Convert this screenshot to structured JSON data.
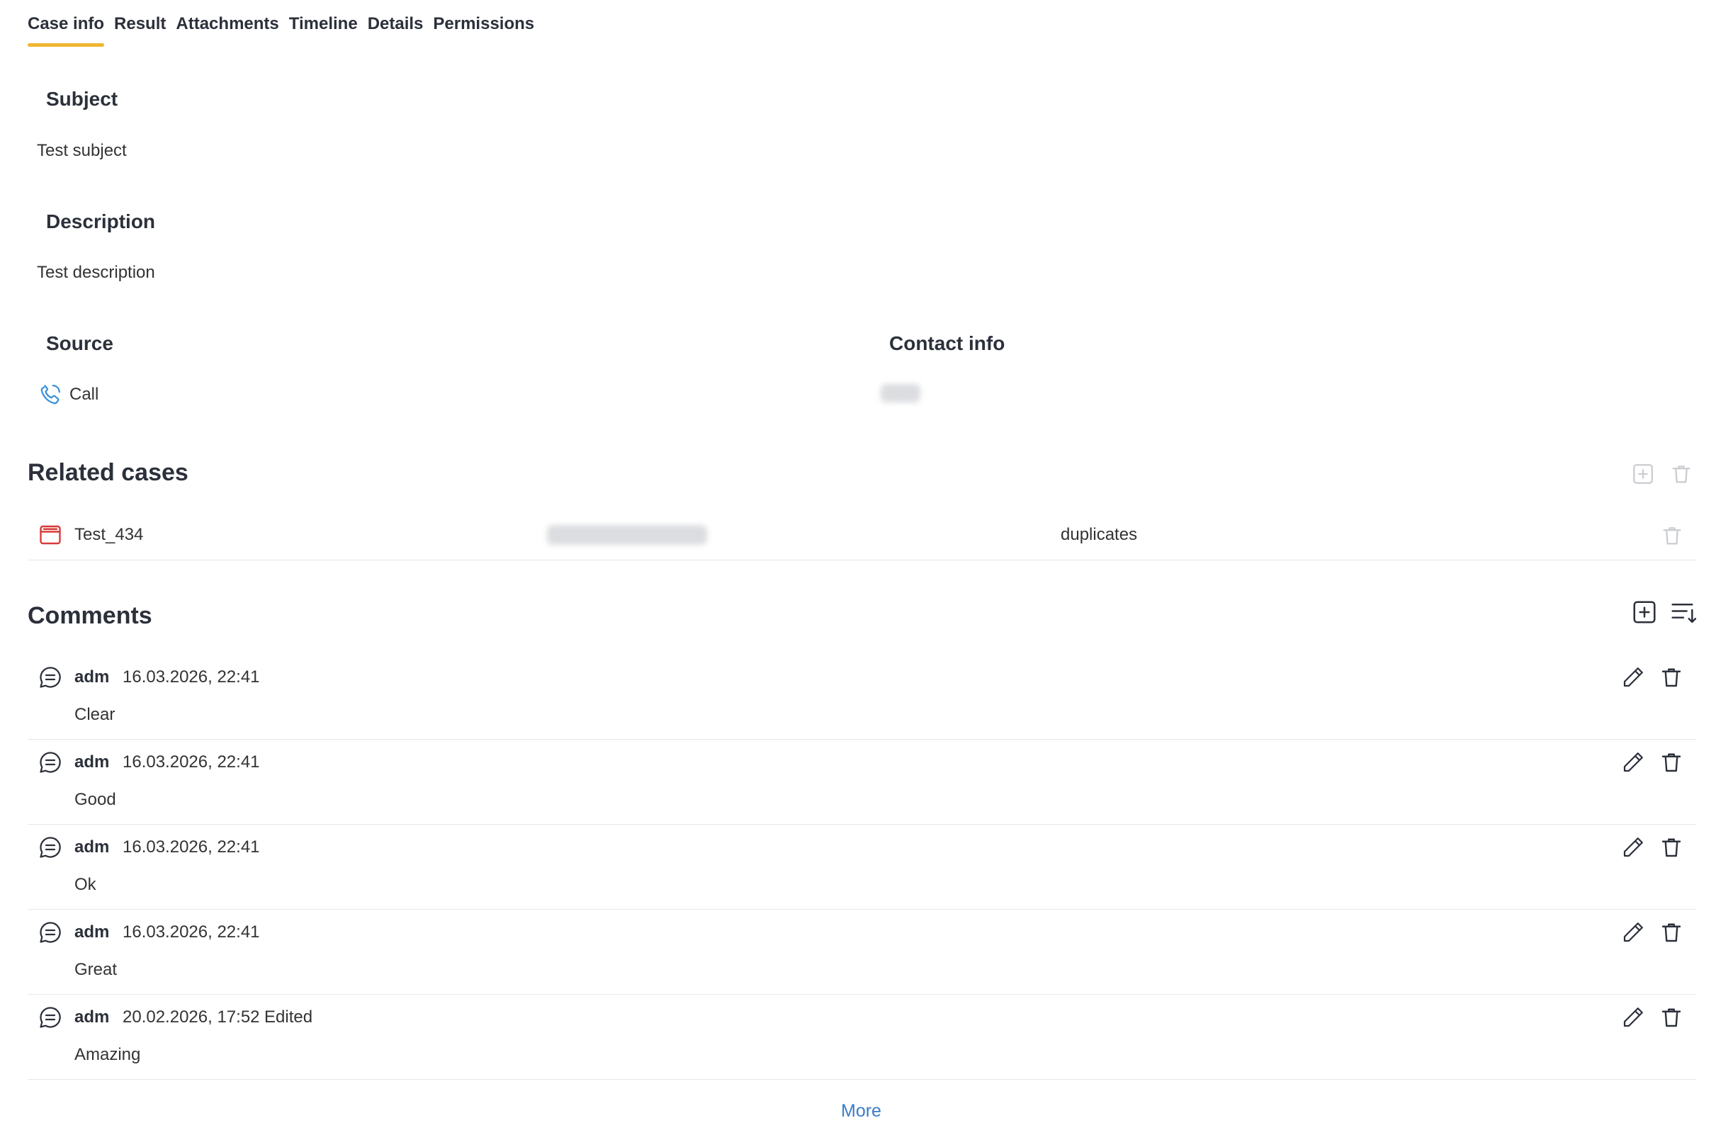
{
  "tabs": [
    "Case info",
    "Result",
    "Attachments",
    "Timeline",
    "Details",
    "Permissions"
  ],
  "active_tab": "Case info",
  "subject": {
    "label": "Subject",
    "value": "Test subject"
  },
  "description": {
    "label": "Description",
    "value": "Test description"
  },
  "source": {
    "label": "Source",
    "value": "Call",
    "icon": "phone-icon"
  },
  "contact": {
    "label": "Contact info"
  },
  "related_cases": {
    "title": "Related cases",
    "items": [
      {
        "name": "Test_434",
        "relation": "duplicates",
        "icon": "case-folder-icon"
      }
    ]
  },
  "comments": {
    "title": "Comments",
    "items": [
      {
        "author": "adm",
        "date": "16.03.2026, 22:41",
        "text": "Clear"
      },
      {
        "author": "adm",
        "date": "16.03.2026, 22:41",
        "text": "Good"
      },
      {
        "author": "adm",
        "date": "16.03.2026, 22:41",
        "text": "Ok"
      },
      {
        "author": "adm",
        "date": "16.03.2026, 22:41",
        "text": "Great"
      },
      {
        "author": "adm",
        "date": "20.02.2026, 17:52",
        "edited": "Edited",
        "text": "Amazing"
      }
    ],
    "more_label": "More"
  },
  "colors": {
    "accent": "#f0b632",
    "link": "#3a7cc8",
    "phone_icon": "#3a8fd9",
    "case_icon": "#d83a3a",
    "text": "#2b303a"
  }
}
